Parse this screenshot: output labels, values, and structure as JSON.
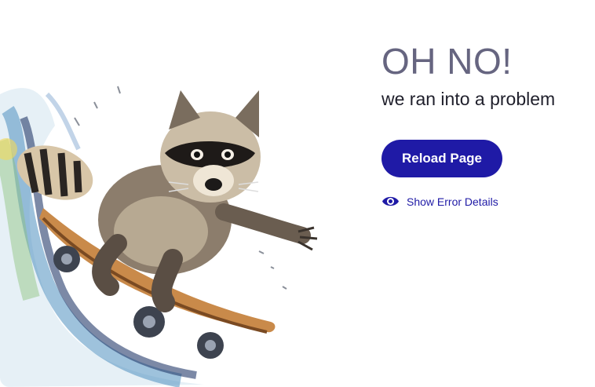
{
  "error_page": {
    "title": "OH NO!",
    "subtitle": "we ran into a problem",
    "reload_label": "Reload Page",
    "details_label": "Show Error Details"
  },
  "colors": {
    "accent": "#1f1aa6",
    "title": "#666580",
    "text": "#1f1f2b",
    "background": "#ffffff"
  },
  "icons": {
    "details_icon": "eye-icon",
    "illustration": "raccoon-skateboard-illustration"
  }
}
